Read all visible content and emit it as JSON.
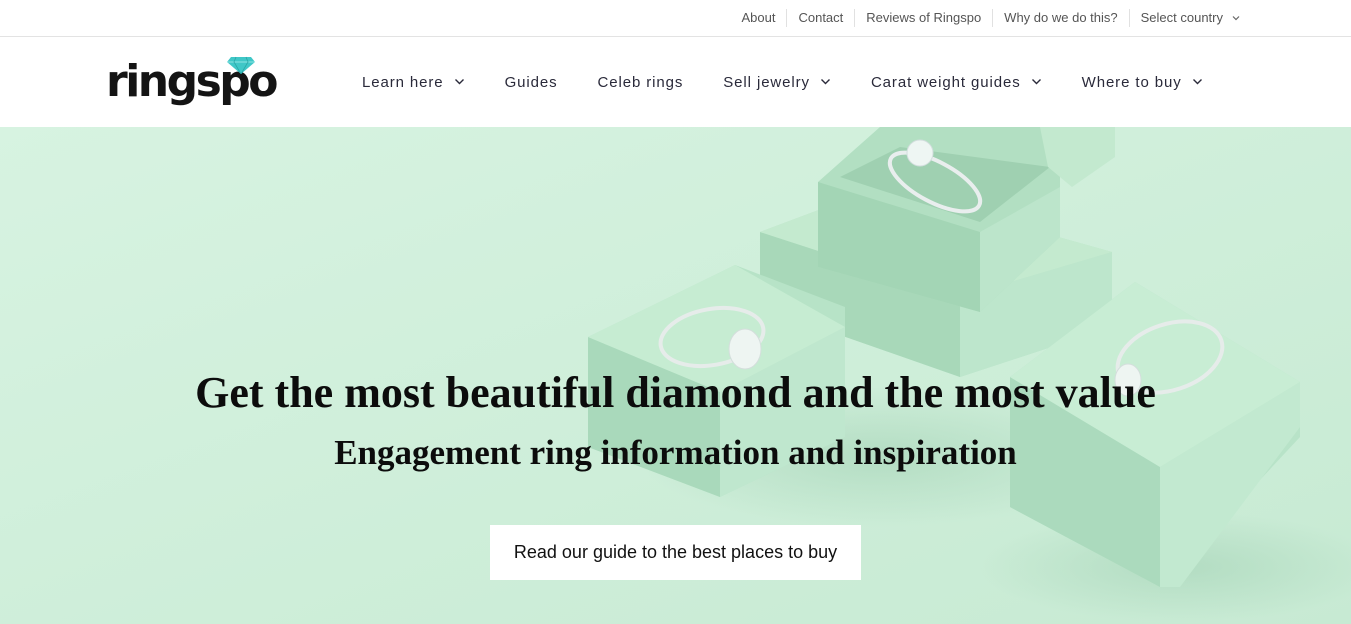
{
  "topbar": {
    "links": [
      "About",
      "Contact",
      "Reviews of Ringspo",
      "Why do we do this?"
    ],
    "country_select": "Select country"
  },
  "header": {
    "logo_text": "ringspo",
    "nav": [
      {
        "label": "Learn here",
        "has_dropdown": true
      },
      {
        "label": "Guides",
        "has_dropdown": false
      },
      {
        "label": "Celeb rings",
        "has_dropdown": false
      },
      {
        "label": "Sell jewelry",
        "has_dropdown": true
      },
      {
        "label": "Carat weight guides",
        "has_dropdown": true
      },
      {
        "label": "Where to buy",
        "has_dropdown": true
      }
    ]
  },
  "hero": {
    "title": "Get the most beautiful diamond and the most value",
    "subtitle": "Engagement ring information and inspiration",
    "cta_label": "Read our guide to the best places to buy"
  },
  "colors": {
    "hero_background": "#cfeedb",
    "logo_gem": "#3fc7c7",
    "nav_text": "#2a2a3a"
  },
  "icons": {
    "dropdown": "chevron-down-icon",
    "logo_gem": "diamond-icon"
  }
}
